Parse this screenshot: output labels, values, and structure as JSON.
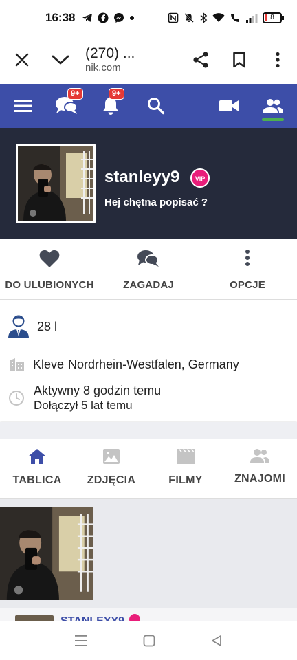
{
  "status_bar": {
    "time": "16:38",
    "battery": "8"
  },
  "browser": {
    "title": "(270) ...",
    "url": "nik.com"
  },
  "nav": {
    "messages_badge": "9+",
    "notifications_badge": "9+",
    "accent": "#3d4ea8",
    "active_indicator": "#4caf50"
  },
  "profile": {
    "username": "stanleyy9",
    "vip_label": "VIP",
    "tagline": "Hej chętna popisać ?"
  },
  "actions": [
    {
      "label": "DO ULUBIONYCH",
      "icon": "heart-icon"
    },
    {
      "label": "ZAGADAJ",
      "icon": "chat-icon"
    },
    {
      "label": "OPCJE",
      "icon": "more-vertical-icon"
    }
  ],
  "info": {
    "age": "28 l",
    "city": "Kleve",
    "region": "Nordrhein-Westfalen, Germany",
    "active": "Aktywny 8 godzin temu",
    "joined": "Dołączył 5 lat temu"
  },
  "tabs": [
    {
      "label": "TABLICA",
      "icon": "home-icon",
      "active": true
    },
    {
      "label": "ZDJĘCIA",
      "icon": "image-icon",
      "active": false
    },
    {
      "label": "FILMY",
      "icon": "film-icon",
      "active": false
    },
    {
      "label": "ZNAJOMI",
      "icon": "friends-icon",
      "active": false
    }
  ],
  "feed": {
    "partial_title": "STANLEYY9"
  }
}
